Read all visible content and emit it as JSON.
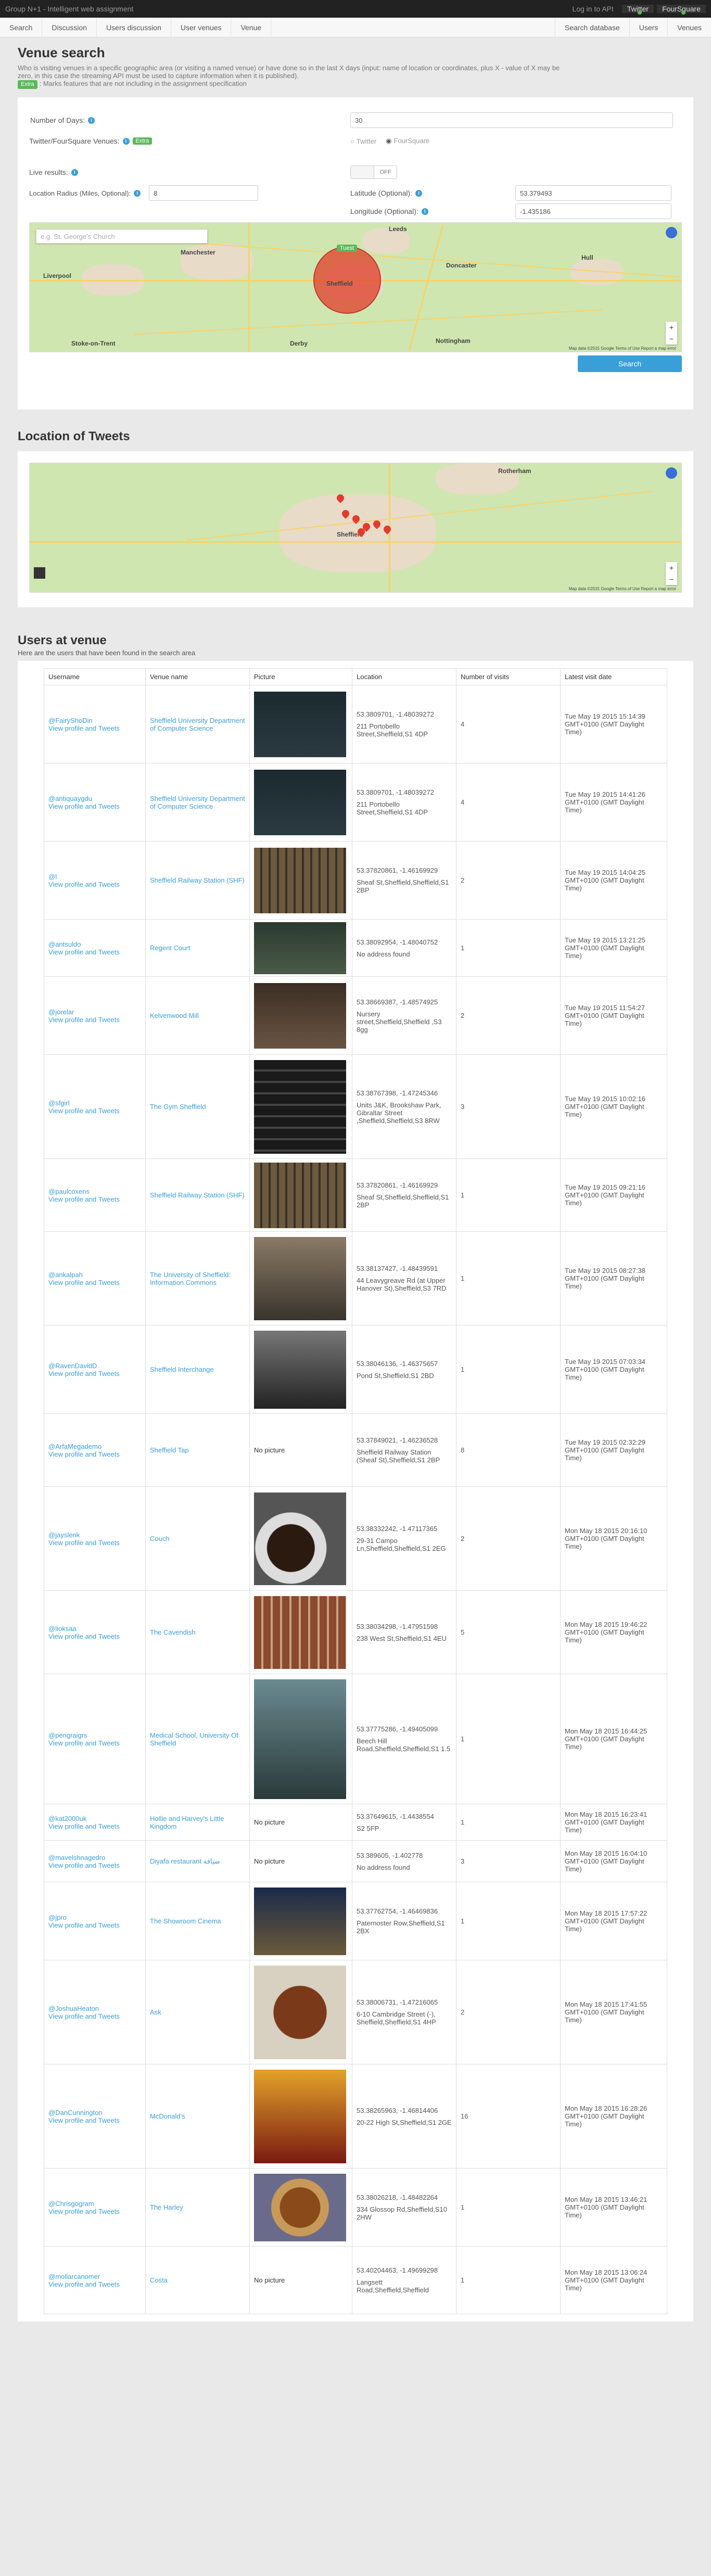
{
  "topbar": {
    "brand": "Group N+1 - Intelligent web assignment",
    "login": "Log in to API",
    "twitter": "Twitter",
    "foursquare": "FourSquare"
  },
  "nav": {
    "left": [
      "Search",
      "Discussion",
      "Users discussion",
      "User venues",
      "Venue"
    ],
    "right": [
      "Search database",
      "Users",
      "Venues"
    ]
  },
  "venue_search": {
    "title": "Venue search",
    "lead1": "Who is visiting venues in a specific geographic area (or visiting a named venue) or have done so in the last X days (input: name of location or coordinates, plus X - value of X may be",
    "lead2": "zero, in this case the streaming API must be used to capture information when it is published).",
    "extra_badge": "Extra",
    "extra_note": ": Marks features that are not including in the assignment specification",
    "days_label": "Number of Days:",
    "days_value": "30",
    "venues_label": "Twitter/FourSquare Venues:",
    "twitter_option": "Twitter",
    "foursquare_option": "FourSquare",
    "live_label": "Live results:",
    "toggle_label": "OFF",
    "lat_label": "Latitude (Optional):",
    "lat_value": "53.379493",
    "radius_label": "Location Radius (Miles, Optional):",
    "radius_value": "8",
    "lon_label": "Longitude (Optional):",
    "lon_value": "-1.435186",
    "map_search_placeholder": "e.g. St. George's Church",
    "map_labels": [
      "Liverpool",
      "Manchester",
      "Sheffield",
      "Leeds",
      "Stoke-on-Trent",
      "Derby",
      "Nottingham",
      "Hull",
      "Doncaster"
    ],
    "map_badge": "Tuest",
    "map_footer": "Map data ©2015 Google  Terms of Use  Report a map error",
    "search_button": "Search"
  },
  "tweets_map": {
    "title": "Location of Tweets",
    "labels": [
      "Rotherham",
      "Sheffield"
    ],
    "footer": "Map data ©2015 Google  Terms of Use  Report a map error"
  },
  "users": {
    "title": "Users at venue",
    "subtitle": "Here are the users that have been found in the search area",
    "profile_link": "View profile and Tweets",
    "headers": [
      "Username",
      "Venue name",
      "Picture",
      "Location",
      "Number of visits",
      "Latest visit date"
    ],
    "rows": [
      {
        "user": "@FairyShoDin",
        "venue": "Sheffield University Department of Computer Science",
        "pic": "slide",
        "coords": "53.3809701, -1.48039272",
        "addr": "211 Portobello Street,Sheffield,S1 4DP",
        "visits": "4",
        "date": "Tue May 19 2015 15:14:39 GMT+0100 (GMT Daylight Time)"
      },
      {
        "user": "@antiquaygdu",
        "venue": "Sheffield University Department of Computer Science",
        "pic": "slide",
        "coords": "53.3809701, -1.48039272",
        "addr": "211 Portobello Street,Sheffield,S1 4DP",
        "visits": "4",
        "date": "Tue May 19 2015 14:41:26 GMT+0100 (GMT Daylight Time)"
      },
      {
        "user": "@l",
        "venue": "Sheffield Railway Station (SHF)",
        "pic": "station",
        "coords": "53.37820861, -1.46169929",
        "addr": "Sheaf St,Sheffield,Sheffield,S1 2BP",
        "visits": "2",
        "date": "Tue May 19 2015 14:04:25 GMT+0100 (GMT Daylight Time)"
      },
      {
        "user": "@antsuldo",
        "venue": "Regent Court",
        "pic": "board",
        "coords": "53.38092954, -1.48040752",
        "addr": "No address found",
        "visits": "1",
        "date": "Tue May 19 2015 13:21:25 GMT+0100 (GMT Daylight Time)"
      },
      {
        "user": "@jorelar",
        "venue": "Kelvenwood Mill",
        "pic": "mill",
        "coords": "53.38669387, -1.48574925",
        "addr": "Nursery street,Sheffield,Sheffield ,S3 8gg",
        "visits": "2",
        "date": "Tue May 19 2015 11:54:27 GMT+0100 (GMT Daylight Time)"
      },
      {
        "user": "@sfgirl",
        "venue": "The Gym Sheffield",
        "pic": "gym",
        "coords": "53.38767398, -1.47245346",
        "addr": "Units J&K, Brookshaw Park, Gibraltar Street ,Sheffield,Sheffield,S3 8RW",
        "visits": "3",
        "date": "Tue May 19 2015 10:02:16 GMT+0100 (GMT Daylight Time)"
      },
      {
        "user": "@paulcoxens",
        "venue": "Sheffield Railway Station (SHF)",
        "pic": "station",
        "coords": "53.37820861, -1.46169929",
        "addr": "Sheaf St,Sheffield,Sheffield,S1 2BP",
        "visits": "1",
        "date": "Tue May 19 2015 09:21:16 GMT+0100 (GMT Daylight Time)"
      },
      {
        "user": "@ankalpah",
        "venue": "The University of Sheffield: Information Commons",
        "pic": "library",
        "coords": "53.38137427, -1.48439591",
        "addr": "44 Leavygreave Rd (at Upper Hanover St),Sheffield,S3 7RD",
        "visits": "1",
        "date": "Tue May 19 2015 08:27:38 GMT+0100 (GMT Daylight Time)"
      },
      {
        "user": "@RavenDavidD",
        "venue": "Sheffield Interchange",
        "pic": "interchange",
        "coords": "53.38046136, -1.46375657",
        "addr": "Pond St,Sheffield,S1 2BD",
        "visits": "1",
        "date": "Tue May 19 2015 07:03:34 GMT+0100 (GMT Daylight Time)"
      },
      {
        "user": "@ArfaMegademo",
        "venue": "Sheffield Tap",
        "pic": "",
        "coords": "53.37849021, -1.46236528",
        "addr": "Sheffield Railway Station (Sheaf St),Sheffield,S1 2BP",
        "visits": "8",
        "date": "Tue May 19 2015 02:32:29 GMT+0100 (GMT Daylight Time)"
      },
      {
        "user": "@jayslenk",
        "venue": "Couch",
        "pic": "coffee",
        "coords": "53.38332242, -1.47117365",
        "addr": "29-31 Campo Ln,Sheffield,Sheffield,S1 2EG",
        "visits": "2",
        "date": "Mon May 18 2015 20:16:10 GMT+0100 (GMT Daylight Time)"
      },
      {
        "user": "@lioksaa",
        "venue": "The Cavendish",
        "pic": "pub",
        "coords": "53.38034298, -1.47951598",
        "addr": "238 West St,Sheffield,S1 4EU",
        "visits": "5",
        "date": "Mon May 18 2015 19:46:22 GMT+0100 (GMT Daylight Time)"
      },
      {
        "user": "@pengraigrs",
        "venue": "Medical School, University Of Sheffield",
        "pic": "medical",
        "coords": "53.37775286, -1.49405099",
        "addr": "Beech Hill Road,Sheffield,Sheffield,S1 1.5",
        "visits": "1",
        "date": "Mon May 18 2015 16:44:25 GMT+0100 (GMT Daylight Time)"
      },
      {
        "user": "@kat2000uk",
        "venue": "Hollie and Harvey's Little Kingdom",
        "pic": "",
        "coords": "53.37649615, -1.4438554",
        "addr": "S2 5FP",
        "visits": "1",
        "date": "Mon May 18 2015 16:23:41 GMT+0100 (GMT Daylight Time)"
      },
      {
        "user": "@mavelshnagedro",
        "venue": "Diyafa restaurant ضيافة",
        "pic": "",
        "coords": "53.389605, -1.402778",
        "addr": "No address found",
        "visits": "3",
        "date": "Mon May 18 2015 16:04:10 GMT+0100 (GMT Daylight Time)"
      },
      {
        "user": "@jpro",
        "venue": "The Showroom Cinema",
        "pic": "cinema",
        "coords": "53.37762754, -1.46469836",
        "addr": "Paternoster Row,Sheffield,S1 2BX",
        "visits": "1",
        "date": "Mon May 18 2015 17:57:22 GMT+0100 (GMT Daylight Time)"
      },
      {
        "user": "@JoshuaHeaton",
        "venue": "Ask",
        "pic": "food",
        "coords": "53.38006731, -1.47216065",
        "addr": "6-10 Cambridge Street (-), Sheffield,Sheffield,S1 4HP",
        "visits": "2",
        "date": "Mon May 18 2015 17:41:55 GMT+0100 (GMT Daylight Time)"
      },
      {
        "user": "@DanCunnington",
        "venue": "McDonald's",
        "pic": "fries",
        "coords": "53.38265963, -1.46814406",
        "addr": "20-22 High St,Sheffield,S1 2GE",
        "visits": "16",
        "date": "Mon May 18 2015 16:28:26 GMT+0100 (GMT Daylight Time)"
      },
      {
        "user": "@Chrisgogram",
        "venue": "The Harley",
        "pic": "burger",
        "coords": "53.38026218, -1.48482264",
        "addr": "334 Glossop Rd,Sheffield,S10 2HW",
        "visits": "1",
        "date": "Mon May 18 2015 13:46:21 GMT+0100 (GMT Daylight Time)"
      },
      {
        "user": "@mollarcanomer",
        "venue": "Costa",
        "pic": "",
        "coords": "53.40204463, -1.49699298",
        "addr": "Langsett Road,Sheffield,Sheffield",
        "visits": "1",
        "date": "Mon May 18 2015 13:06:24 GMT+0100 (GMT Daylight Time)"
      }
    ],
    "no_picture": "No picture"
  }
}
